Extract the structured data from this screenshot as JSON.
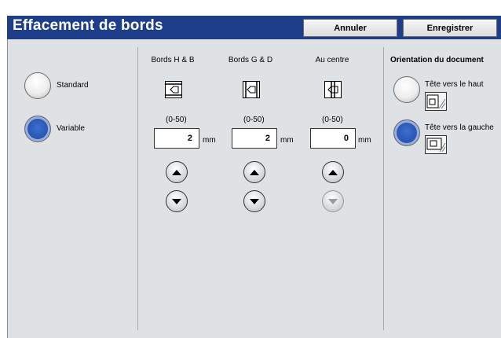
{
  "header": {
    "title": "Effacement de bords",
    "cancel_label": "Annuler",
    "save_label": "Enregistrer"
  },
  "mode": {
    "options": [
      {
        "label": "Standard",
        "selected": false
      },
      {
        "label": "Variable",
        "selected": true
      }
    ]
  },
  "edges": [
    {
      "heading": "Bords H & B",
      "range": "(0-50)",
      "value": "2",
      "unit": "mm",
      "icon": "edge-top-bottom-icon",
      "down_enabled": true
    },
    {
      "heading": "Bords G & D",
      "range": "(0-50)",
      "value": "2",
      "unit": "mm",
      "icon": "edge-left-right-icon",
      "down_enabled": true
    },
    {
      "heading": "Au centre",
      "range": "(0-50)",
      "value": "0",
      "unit": "mm",
      "icon": "edge-center-icon",
      "down_enabled": false
    }
  ],
  "orientation": {
    "heading": "Orientation du document",
    "options": [
      {
        "label": "Tête vers le haut",
        "selected": false
      },
      {
        "label": "Tête vers la gauche",
        "selected": true
      }
    ]
  },
  "colors": {
    "header": "#1f3e8a",
    "panel": "#dfe2e5",
    "selected_radio": "#2a56b5"
  }
}
